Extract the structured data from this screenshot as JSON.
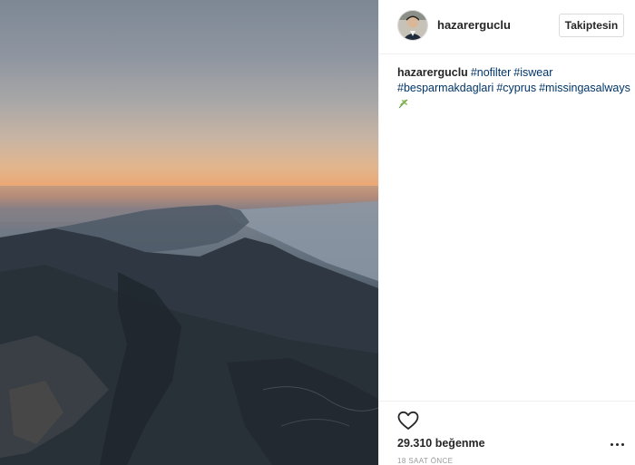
{
  "post": {
    "photo_alt": "",
    "header": {
      "username": "hazarerguclu",
      "follow_label": "Takiptesin"
    },
    "caption": {
      "username": "hazarerguclu",
      "hashtags": [
        "#nofilter",
        "#iswear",
        "#besparmakdaglari",
        "#cyprus",
        "#missingasalways"
      ],
      "trailing_emoji_icon": "herb-leaf-icon"
    },
    "footer": {
      "like_icon": "heart-outline-icon",
      "likes_count": "29.310",
      "likes_label": "beğenme",
      "timestamp": "18 SAAT ÖNCE",
      "more_icon": "ellipsis-icon"
    }
  },
  "colors": {
    "hashtag": "#003569",
    "text": "#262626",
    "muted": "#999999",
    "divider": "#efefef"
  }
}
